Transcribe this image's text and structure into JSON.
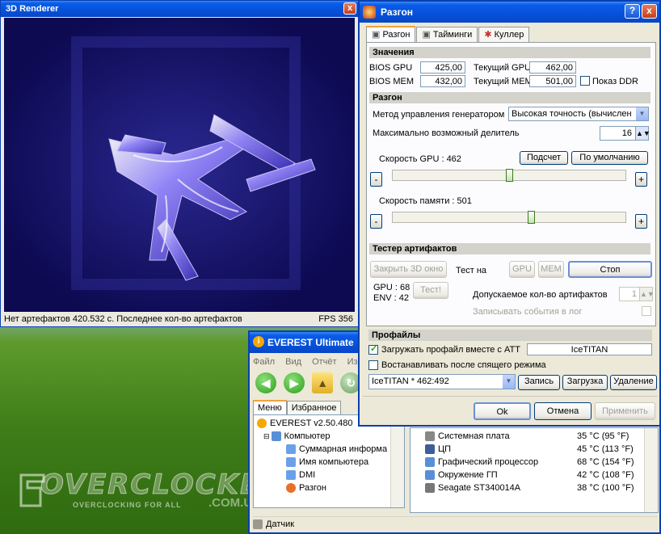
{
  "renderer": {
    "title": "3D Renderer",
    "close_label": "x",
    "status_text": "Нет артефактов 420.532 с. Последнее кол-во артефактов",
    "fps_text": "FPS 356"
  },
  "oc": {
    "title": "Разгон",
    "help_label": "?",
    "close_label": "x",
    "tabs": [
      "Разгон",
      "Тайминги",
      "Куллер"
    ],
    "values": {
      "header": "Значения",
      "bios_gpu_label": "BIOS GPU",
      "bios_gpu_value": "425,00",
      "bios_mem_label": "BIOS MEM",
      "bios_mem_value": "432,00",
      "cur_gpu_label": "Текущий GPU",
      "cur_gpu_value": "462,00",
      "cur_mem_label": "Текущий MEM",
      "cur_mem_value": "501,00",
      "show_ddr_label": "Показ DDR"
    },
    "overclock": {
      "header": "Разгон",
      "method_label": "Метод управления генератором",
      "method_value": "Высокая точность (вычислен",
      "max_div_label": "Максимально возможный делитель",
      "max_div_value": "16",
      "calc_button": "Подсчет",
      "default_button": "По умолчанию",
      "gpu_speed_label": "Скорость GPU : 462",
      "gpu_slider_level": 0.5,
      "mem_speed_label": "Скорость памяти : 501",
      "mem_slider_level": 0.6,
      "minus": "-",
      "plus": "+"
    },
    "tester": {
      "header": "Тестер артифактов",
      "close3d_button": "Закрыть 3D окно",
      "test_on_label": "Тест на",
      "gpu_button": "GPU",
      "mem_button": "MEM",
      "stop_button": "Стоп",
      "gpu_temp": "GPU : 68",
      "env_temp": "ENV : 42",
      "test_button": "Тест!",
      "allowed_label": "Допускаемое кол-во артифактов",
      "allowed_value": "1",
      "log_label": "Записывать события в лог"
    },
    "profiles": {
      "header": "Профайлы",
      "load_with_att_label": "Загружать профайл вместе с ATT",
      "profile_name": "IceTITAN",
      "restore_label": "Востанавливать после спящего режима",
      "selected_profile": "IceTITAN * 462:492",
      "save_button": "Запись",
      "load_button": "Загрузка",
      "delete_button": "Удаление"
    },
    "ok_button": "Ok",
    "cancel_button": "Отмена",
    "apply_button": "Применить"
  },
  "everest": {
    "title": "EVEREST Ultimate",
    "menu": [
      "Файл",
      "Вид",
      "Отчёт",
      "Из"
    ],
    "tabs": [
      "Меню",
      "Избранное"
    ],
    "tree": {
      "root": "EVEREST v2.50.480",
      "computer": "Компьютер",
      "items": [
        "Суммарная информа",
        "Имя компьютера",
        "DMI",
        "Разгон"
      ]
    },
    "sensors": [
      {
        "name": "Системная плата",
        "value": "35 °C  (95 °F)"
      },
      {
        "name": "ЦП",
        "value": "45 °C  (113 °F)"
      },
      {
        "name": "Графический процессор",
        "value": "68 °C  (154 °F)"
      },
      {
        "name": "Окружение ГП",
        "value": "42 °C  (108 °F)"
      },
      {
        "name": "Seagate ST340014A",
        "value": "38 °C  (100 °F)"
      }
    ],
    "status": "Датчик"
  },
  "watermark": {
    "text": "OVERCLOCKERS",
    "sub": "OVERCLOCKING FOR ALL",
    "domain": ".COM.UA"
  }
}
